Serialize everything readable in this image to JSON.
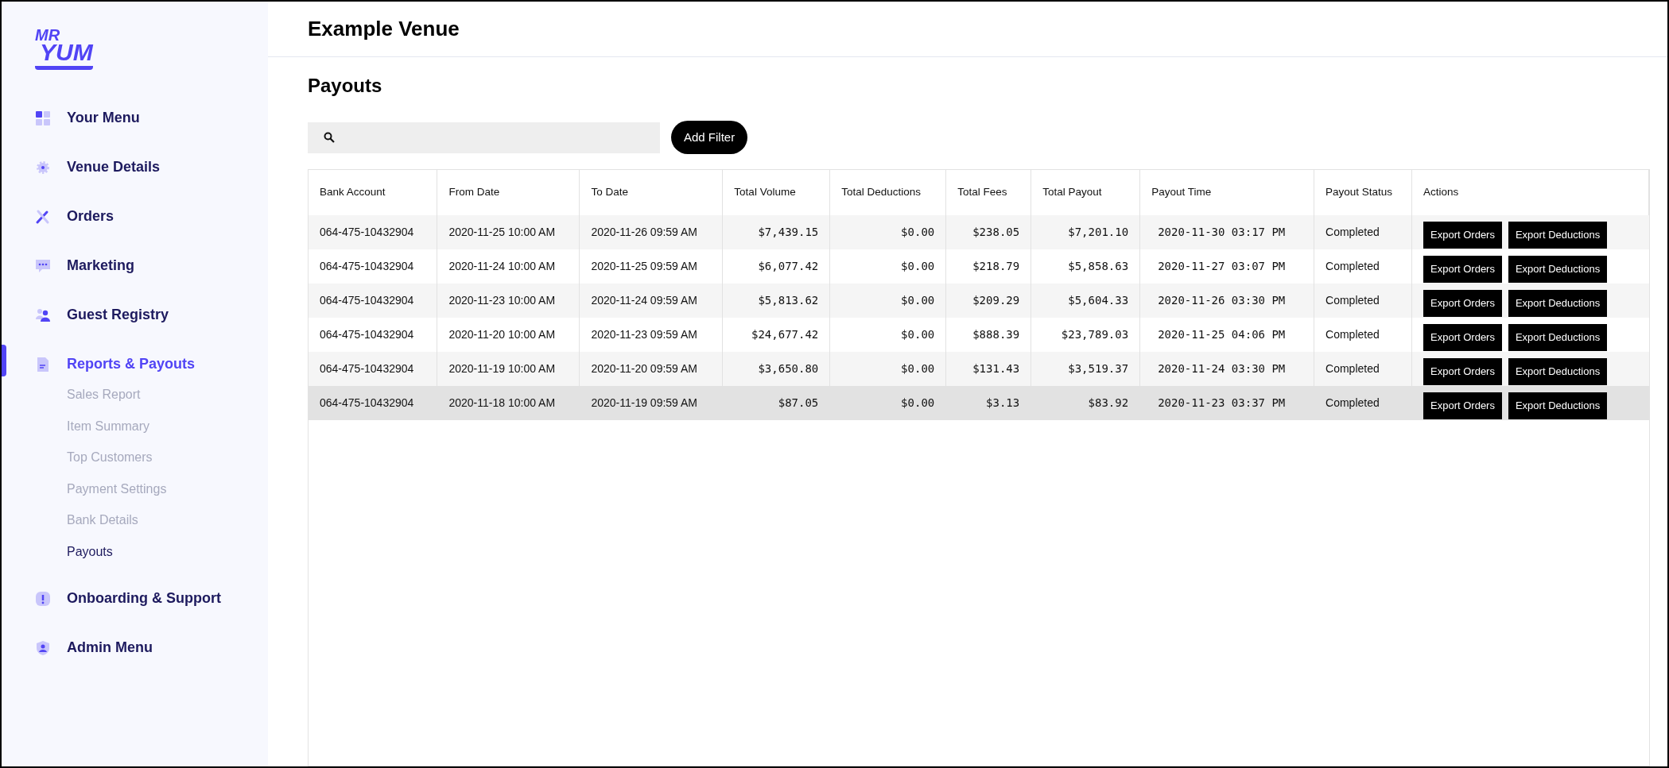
{
  "sidebar": {
    "logo": [
      "MR",
      "YUM"
    ],
    "items": [
      {
        "label": "Your Menu",
        "kind": "grid",
        "selected": false
      },
      {
        "label": "Venue Details",
        "kind": "gear",
        "selected": false
      },
      {
        "label": "Orders",
        "kind": "utensils",
        "selected": false
      },
      {
        "label": "Marketing",
        "kind": "chat",
        "selected": false
      },
      {
        "label": "Guest Registry",
        "kind": "people",
        "selected": false
      },
      {
        "label": "Reports & Payouts",
        "kind": "document",
        "selected": true,
        "children": [
          {
            "label": "Sales Report",
            "selected": false
          },
          {
            "label": "Item Summary",
            "selected": false
          },
          {
            "label": "Top Customers",
            "selected": false
          },
          {
            "label": "Payment Settings",
            "selected": false
          },
          {
            "label": "Bank Details",
            "selected": false
          },
          {
            "label": "Payouts",
            "selected": true
          }
        ]
      },
      {
        "label": "Onboarding & Support",
        "kind": "alert",
        "selected": false
      },
      {
        "label": "Admin Menu",
        "kind": "shield",
        "selected": false
      }
    ]
  },
  "header": {
    "title": "Example Venue"
  },
  "page": {
    "title": "Payouts",
    "add_filter": "Add Filter"
  },
  "table": {
    "columns": [
      "Bank Account",
      "From Date",
      "To Date",
      "Total Volume",
      "Total Deductions",
      "Total Fees",
      "Total Payout",
      "Payout Time",
      "Payout Status",
      "Actions"
    ],
    "rows": [
      {
        "selected": false,
        "cells": [
          "064-475-10432904",
          "2020-11-25 10:00 AM",
          "2020-11-26 09:59 AM",
          "$7,439.15",
          "$0.00",
          "$238.05",
          "$7,201.10",
          "2020-11-30 03:17 PM",
          "Completed"
        ],
        "actions": [
          "Export Orders",
          "Export Deductions"
        ]
      },
      {
        "selected": false,
        "cells": [
          "064-475-10432904",
          "2020-11-24 10:00 AM",
          "2020-11-25 09:59 AM",
          "$6,077.42",
          "$0.00",
          "$218.79",
          "$5,858.63",
          "2020-11-27 03:07 PM",
          "Completed"
        ],
        "actions": [
          "Export Orders",
          "Export Deductions"
        ]
      },
      {
        "selected": false,
        "cells": [
          "064-475-10432904",
          "2020-11-23 10:00 AM",
          "2020-11-24 09:59 AM",
          "$5,813.62",
          "$0.00",
          "$209.29",
          "$5,604.33",
          "2020-11-26 03:30 PM",
          "Completed"
        ],
        "actions": [
          "Export Orders",
          "Export Deductions"
        ]
      },
      {
        "selected": false,
        "cells": [
          "064-475-10432904",
          "2020-11-20 10:00 AM",
          "2020-11-23 09:59 AM",
          "$24,677.42",
          "$0.00",
          "$888.39",
          "$23,789.03",
          "2020-11-25 04:06 PM",
          "Completed"
        ],
        "actions": [
          "Export Orders",
          "Export Deductions"
        ]
      },
      {
        "selected": false,
        "cells": [
          "064-475-10432904",
          "2020-11-19 10:00 AM",
          "2020-11-20 09:59 AM",
          "$3,650.80",
          "$0.00",
          "$131.43",
          "$3,519.37",
          "2020-11-24 03:30 PM",
          "Completed"
        ],
        "actions": [
          "Export Orders",
          "Export Deductions"
        ]
      },
      {
        "selected": true,
        "cells": [
          "064-475-10432904",
          "2020-11-18 10:00 AM",
          "2020-11-19 09:59 AM",
          "$87.05",
          "$0.00",
          "$3.13",
          "$83.92",
          "2020-11-23 03:37 PM",
          "Completed"
        ],
        "actions": [
          "Export Orders",
          "Export Deductions"
        ]
      }
    ]
  }
}
